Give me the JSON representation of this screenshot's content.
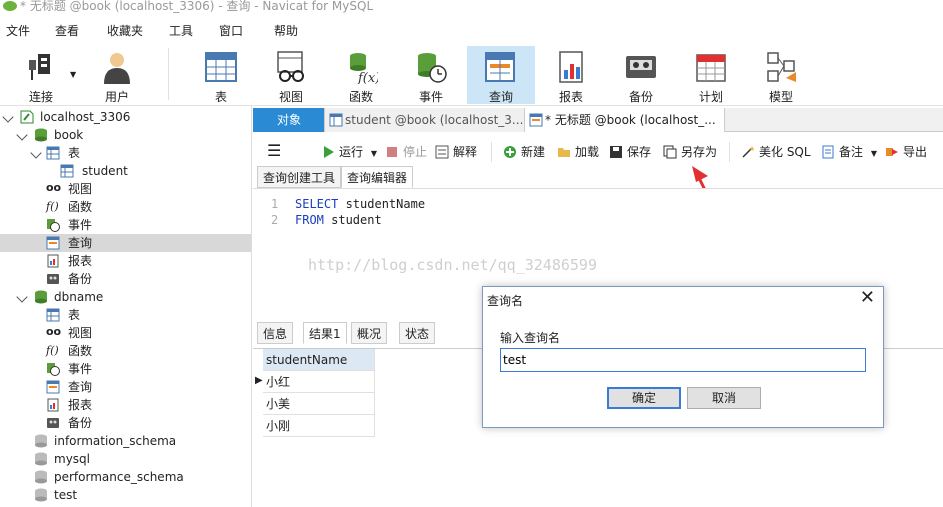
{
  "window": {
    "title": "* 无标题 @book (localhost_3306) - 查询 - Navicat for MySQL"
  },
  "menu": [
    "文件",
    "查看",
    "收藏夹",
    "工具",
    "窗口",
    "帮助"
  ],
  "toolbar": {
    "connect": "连接",
    "user": "用户",
    "table": "表",
    "view": "视图",
    "function": "函数",
    "event": "事件",
    "query": "查询",
    "report": "报表",
    "backup": "备份",
    "schedule": "计划",
    "model": "模型"
  },
  "sidebar": {
    "connection": "localhost_3306",
    "db1": {
      "name": "book",
      "items": [
        "表",
        "student",
        "视图",
        "函数",
        "事件",
        "查询",
        "报表",
        "备份"
      ]
    },
    "db2": {
      "name": "dbname",
      "items": [
        "表",
        "视图",
        "函数",
        "事件",
        "查询",
        "报表",
        "备份"
      ]
    },
    "others": [
      "information_schema",
      "mysql",
      "performance_schema",
      "test"
    ]
  },
  "tabs": {
    "objects": "对象",
    "tab1": "student @book (localhost_3...",
    "tab2": "* 无标题 @book (localhost_..."
  },
  "query_toolbar": {
    "run": "运行",
    "stop": "停止",
    "explain": "解释",
    "new": "新建",
    "load": "加载",
    "save": "保存",
    "save_as": "另存为",
    "beautify": "美化 SQL",
    "comment": "备注",
    "export": "导出"
  },
  "subtabs": {
    "builder": "查询创建工具",
    "editor": "查询编辑器"
  },
  "editor": {
    "line1_no": "1",
    "line1_kw": "SELECT",
    "line1_rest": " studentName",
    "line2_no": "2",
    "line2_kw": "FROM",
    "line2_rest": " student"
  },
  "watermark": "http://blog.csdn.net/qq_32486599",
  "result_tabs": {
    "info": "信息",
    "result1": "结果1",
    "overview": "概况",
    "status": "状态"
  },
  "grid": {
    "column": "studentName",
    "rows": [
      "小红",
      "小美",
      "小刚"
    ]
  },
  "dialog": {
    "title": "查询名",
    "label": "输入查询名",
    "value": "test",
    "ok": "确定",
    "cancel": "取消"
  },
  "colors": {
    "accent": "#3a7bd5",
    "active_tab": "#2a8ad4",
    "arrow": "#e03030"
  }
}
